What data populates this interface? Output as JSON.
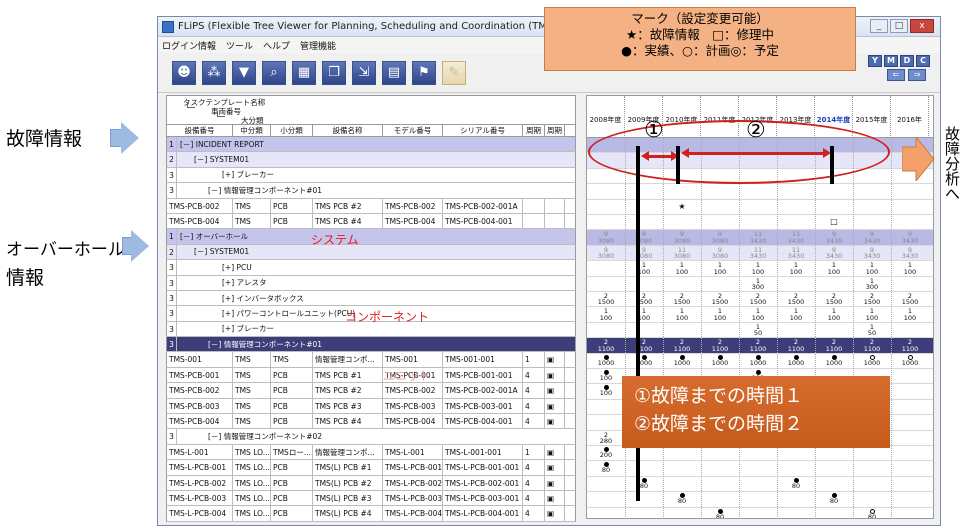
{
  "window": {
    "title": "FLiPS (Flexible Tree Viewer for Planning, Scheduling and Coordination (TM))",
    "buttons": [
      "_",
      "□",
      "x"
    ]
  },
  "menu": [
    "ログイン情報",
    "ツール",
    "ヘルプ",
    "管理機能"
  ],
  "toolbar_icons": [
    "people-icon",
    "network-icon",
    "filter-icon",
    "search-icon",
    "grid-icon",
    "window-icon",
    "export-icon",
    "calendar-icon",
    "pin-icon",
    "note-icon"
  ],
  "view_buttons": [
    "Y",
    "M",
    "D",
    "C"
  ],
  "side_labels": {
    "failure": "故障情報",
    "overhaul_line1": "オーバーホール",
    "overhaul_line2": "情報",
    "analysis": "故障分析へ"
  },
  "mark_box": {
    "line1": "マーク（設定変更可能）",
    "line2": "★：故障情報　□：修理中",
    "line3": "●：実績、○：計画◎：予定"
  },
  "annotations": {
    "system": "システム",
    "component": "コンポーネント",
    "unit": "ユニット",
    "circle1": "①",
    "circle2": "②",
    "explain1": "①故障までの時間１",
    "explain2": "②故障までの時間２"
  },
  "grid_header": {
    "level1": "タスクテンプレート名称",
    "level2": "車両番号",
    "level3": "大分類",
    "columns": [
      "設備番号",
      "中分類",
      "小分類",
      "設備名称",
      "モデル番号",
      "シリアル番号",
      "周期",
      "周期"
    ]
  },
  "years": [
    "2008年度",
    "2009年度",
    "2010年度",
    "2011年度",
    "2012年度",
    "2013年度",
    "2014年度",
    "2015年度",
    "2016年"
  ],
  "current_year": "2014年度",
  "rows": [
    {
      "n": "1",
      "indent": 0,
      "text": "[－] INCIDENT REPORT",
      "style": "group-dark"
    },
    {
      "n": "2",
      "indent": 1,
      "text": "[－] SYSTEM01",
      "style": "group"
    },
    {
      "n": "3",
      "indent": 3,
      "text": "[+] ブレーカー",
      "style": "plain"
    },
    {
      "n": "3",
      "indent": 2,
      "text": "[－] 情報管理コンポーネント#01",
      "style": "plain"
    },
    {
      "cells": [
        "TMS-PCB-002",
        "TMS",
        "PCB",
        "TMS PCB #2",
        "TMS-PCB-002",
        "TMS-PCB-002-001A",
        "",
        ""
      ]
    },
    {
      "cells": [
        "TMS-PCB-004",
        "TMS",
        "PCB",
        "TMS PCB #4",
        "TMS-PCB-004",
        "TMS-PCB-004-001",
        "",
        ""
      ]
    },
    {
      "n": "1",
      "indent": 0,
      "text": "[－] オーバーホール",
      "style": "group-dark"
    },
    {
      "n": "2",
      "indent": 1,
      "text": "[－] SYSTEM01",
      "style": "group"
    },
    {
      "n": "3",
      "indent": 3,
      "text": "[+] PCU",
      "style": "plain"
    },
    {
      "n": "3",
      "indent": 3,
      "text": "[+] アレスタ",
      "style": "plain"
    },
    {
      "n": "3",
      "indent": 3,
      "text": "[+] インバータボックス",
      "style": "plain"
    },
    {
      "n": "3",
      "indent": 3,
      "text": "[+] パワーコントロールユニット(PCU)",
      "style": "plain"
    },
    {
      "n": "3",
      "indent": 3,
      "text": "[+] ブレーカー",
      "style": "plain"
    },
    {
      "n": "3",
      "indent": 2,
      "text": "[－] 情報管理コンポーネント#01",
      "style": "selected"
    },
    {
      "cells": [
        "TMS-001",
        "TMS",
        "TMS",
        "情報管理コンポ...",
        "TMS-001",
        "TMS-001-001",
        "1",
        "▣"
      ]
    },
    {
      "cells": [
        "TMS-PCB-001",
        "TMS",
        "PCB",
        "TMS PCB #1",
        "TMS-PCB-001",
        "TMS-PCB-001-001",
        "4",
        "▣"
      ]
    },
    {
      "cells": [
        "TMS-PCB-002",
        "TMS",
        "PCB",
        "TMS PCB #2",
        "TMS-PCB-002",
        "TMS-PCB-002-001A",
        "4",
        "▣"
      ]
    },
    {
      "cells": [
        "TMS-PCB-003",
        "TMS",
        "PCB",
        "TMS PCB #3",
        "TMS-PCB-003",
        "TMS-PCB-003-001",
        "4",
        "▣"
      ]
    },
    {
      "cells": [
        "TMS-PCB-004",
        "TMS",
        "PCB",
        "TMS PCB #4",
        "TMS-PCB-004",
        "TMS-PCB-004-001",
        "4",
        "▣"
      ]
    },
    {
      "n": "3",
      "indent": 2,
      "text": "[－] 情報管理コンポーネント#02",
      "style": "plain"
    },
    {
      "cells": [
        "TMS-L-001",
        "TMS LO...",
        "TMSロー...",
        "情報管理コンポ...",
        "TMS-L-001",
        "TMS-L-001-001",
        "1",
        "▣"
      ]
    },
    {
      "cells": [
        "TMS-L-PCB-001",
        "TMS LO...",
        "PCB",
        "TMS(L) PCB #1",
        "TMS-L-PCB-001",
        "TMS-L-PCB-001-001",
        "4",
        "▣"
      ]
    },
    {
      "cells": [
        "TMS-L-PCB-002",
        "TMS LO...",
        "PCB",
        "TMS(L) PCB #2",
        "TMS-L-PCB-002",
        "TMS-L-PCB-002-001",
        "4",
        "▣"
      ]
    },
    {
      "cells": [
        "TMS-L-PCB-003",
        "TMS LO...",
        "PCB",
        "TMS(L) PCB #3",
        "TMS-L-PCB-003",
        "TMS-L-PCB-003-001",
        "4",
        "▣"
      ]
    },
    {
      "cells": [
        "TMS-L-PCB-004",
        "TMS LO...",
        "PCB",
        "TMS(L) PCB #4",
        "TMS-L-PCB-004",
        "TMS-L-PCB-004-001",
        "4",
        "▣"
      ]
    }
  ],
  "timeline": {
    "markers": [
      {
        "row": 4,
        "year": 2,
        "text": "★"
      },
      {
        "row": 5,
        "year": 6,
        "text": "□"
      }
    ],
    "cells": [
      {
        "row": 6,
        "values": [
          "9\n3080",
          "9\n3080",
          "9\n3080",
          "9\n3080",
          "11\n3430",
          "11\n3430",
          "9\n3430",
          "9\n3430",
          "9\n3430"
        ]
      },
      {
        "row": 7,
        "values": [
          "9\n3080",
          "9\n3080",
          "11\n3080",
          "9\n3080",
          "11\n3430",
          "11\n3430",
          "9\n3430",
          "9\n3430",
          "9\n3430"
        ]
      },
      {
        "row": 8,
        "values": [
          "",
          "1\n100",
          "1\n100",
          "1\n100",
          "1\n100",
          "1\n100",
          "1\n100",
          "1\n100",
          "1\n100"
        ]
      },
      {
        "row": 9,
        "values": [
          "",
          "",
          "",
          "",
          "1\n300",
          "",
          "",
          "1\n300",
          ""
        ]
      },
      {
        "row": 10,
        "values": [
          "2\n1500",
          "2\n1500",
          "2\n1500",
          "2\n1500",
          "2\n1500",
          "2\n1500",
          "2\n1500",
          "2\n1500",
          "2\n1500"
        ]
      },
      {
        "row": 11,
        "values": [
          "1\n100",
          "1\n100",
          "1\n100",
          "1\n100",
          "1\n100",
          "1\n100",
          "1\n100",
          "1\n100",
          "1\n100"
        ]
      },
      {
        "row": 12,
        "values": [
          "",
          "",
          "",
          "",
          "1\n50",
          "",
          "",
          "1\n50",
          ""
        ]
      },
      {
        "row": 13,
        "values": [
          "2\n1100",
          "2\n1100",
          "2\n1100",
          "2\n1100",
          "2\n1100",
          "2\n1100",
          "2\n1100",
          "2\n1100",
          "2\n1100"
        ]
      },
      {
        "row": 14,
        "values": [
          "●\n1000",
          "●\n1000",
          "●\n1000",
          "●\n1000",
          "●\n1000",
          "●\n1000",
          "●\n1000",
          "○\n1000",
          "○\n1000"
        ]
      },
      {
        "row": 15,
        "values": [
          "●\n100",
          "",
          "",
          "",
          "●\n100",
          "",
          "",
          "",
          ""
        ]
      },
      {
        "row": 16,
        "values": [
          "●\n100",
          "",
          "",
          "",
          "",
          "",
          "",
          "",
          ""
        ]
      },
      {
        "row": 19,
        "values": [
          "2\n280",
          "",
          "",
          "",
          "",
          "",
          "",
          "",
          ""
        ]
      },
      {
        "row": 20,
        "values": [
          "●\n200",
          "",
          "",
          "",
          "",
          "",
          "",
          "",
          ""
        ]
      },
      {
        "row": 21,
        "values": [
          "●\n80",
          "",
          "",
          "",
          "",
          "",
          "",
          "",
          ""
        ]
      },
      {
        "row": 22,
        "values": [
          "",
          "●\n80",
          "",
          "",
          "",
          "●\n80",
          "",
          "",
          ""
        ]
      },
      {
        "row": 23,
        "values": [
          "",
          "",
          "●\n80",
          "",
          "",
          "",
          "●\n80",
          "",
          ""
        ]
      },
      {
        "row": 24,
        "values": [
          "",
          "",
          "",
          "●\n80",
          "",
          "",
          "",
          "○\n80",
          ""
        ]
      }
    ]
  }
}
